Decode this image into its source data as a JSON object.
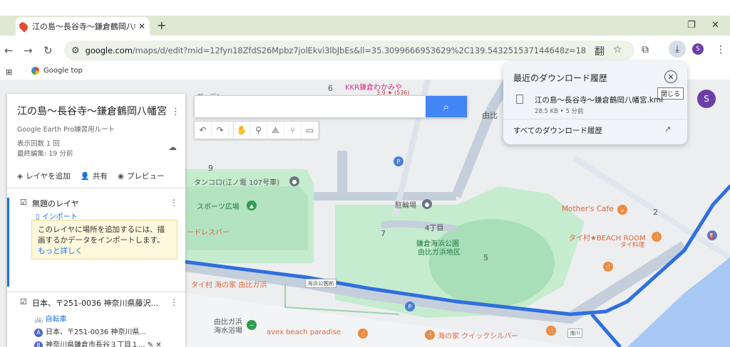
{
  "browser": {
    "tab_title": "江の島〜長谷寺〜鎌倉鶴岡八幡",
    "tab_close": "✕",
    "new_tab": "+",
    "url_domain": "google.com",
    "url_rest": "/maps/d/edit?mid=12fyn18ZfdS26Mpbz7jolEkvi3lbJbEs&ll=35.3099666953629%2C139.543251537144648z=18",
    "bookmark": "Google top",
    "profile_letter": "S",
    "icons": [
      "back-icon",
      "forward-icon",
      "reload-icon",
      "translate-icon",
      "star-icon",
      "extensions-icon",
      "download-icon",
      "menu-icon"
    ]
  },
  "downloads": {
    "title": "最近のダウンロード履歴",
    "close_tooltip": "閉じる",
    "file_name": "江の島〜長谷寺〜鎌倉鶴岡八幡宮.kml",
    "file_meta": "28.5 KB • 5 分前",
    "all_link": "すべてのダウンロード履歴"
  },
  "panel": {
    "title": "江の島〜長谷寺〜鎌倉鶴岡八幡宮",
    "subtitle": "Google Earth Pro練習用ルート",
    "views": "表示回数 1 回",
    "edited": "最終編集: 19 分前",
    "actions": {
      "add_layer": "レイヤを追加",
      "share": "共有",
      "preview": "プレビュー"
    },
    "layer1": {
      "name": "無題のレイヤ",
      "import_link": "インポート",
      "note": "このレイヤに場所を追加するには、描画するかデータをインポートします。",
      "note_more": "もっと詳しく"
    },
    "layer2": {
      "name": "日本、〒251-0036 神奈川県藤沢...",
      "mode": "自転車",
      "point_a_letter": "A",
      "point_a": "日本、〒251-0036 神奈川県...",
      "point_b_letter": "B",
      "point_b": "神奈川県鎌倉市長谷３丁目１..."
    }
  },
  "map": {
    "profile_letter": "S",
    "labels": {
      "kkr": "KKR鎌倉わかみや",
      "kkr_rating": "3.9 ★ (536)",
      "num6": "6",
      "yuigahama": "由比",
      "num9": "9",
      "tanshikoro": "タンコロ(江ノ電 107号車)",
      "sports": "スポーツ広場",
      "bicycle_parking": "駐輪場",
      "dressbar": "ードレスバー",
      "num7": "7",
      "chome4": "4丁目",
      "park1": "鎌倉海浜公園",
      "park2": "由比ガ浜地区",
      "num5": "5",
      "mothers": "Mother's Cafe",
      "taimura_beach": "タイ村★BEACH ROOM",
      "taimura_sub": "タイ料理",
      "num2": "2",
      "umi_no_ie": "タイ村 海の家 由比ガ浜",
      "kaihin_koen": "海浜公園前",
      "yuigahama_swim1": "由比ガ浜",
      "yuigahama_swim2": "海水浴場",
      "avex": "avex beach paradise",
      "quicksilver": "海の家 クイックシルバー",
      "nameri": "滑川",
      "garden_top": "ガーデン"
    },
    "colors": {
      "route": "#2f6fe0",
      "park": "#c6ecd0",
      "park_dark": "#a8deb8",
      "road": "#c5cfdb",
      "water": "#a8c8f5"
    }
  }
}
